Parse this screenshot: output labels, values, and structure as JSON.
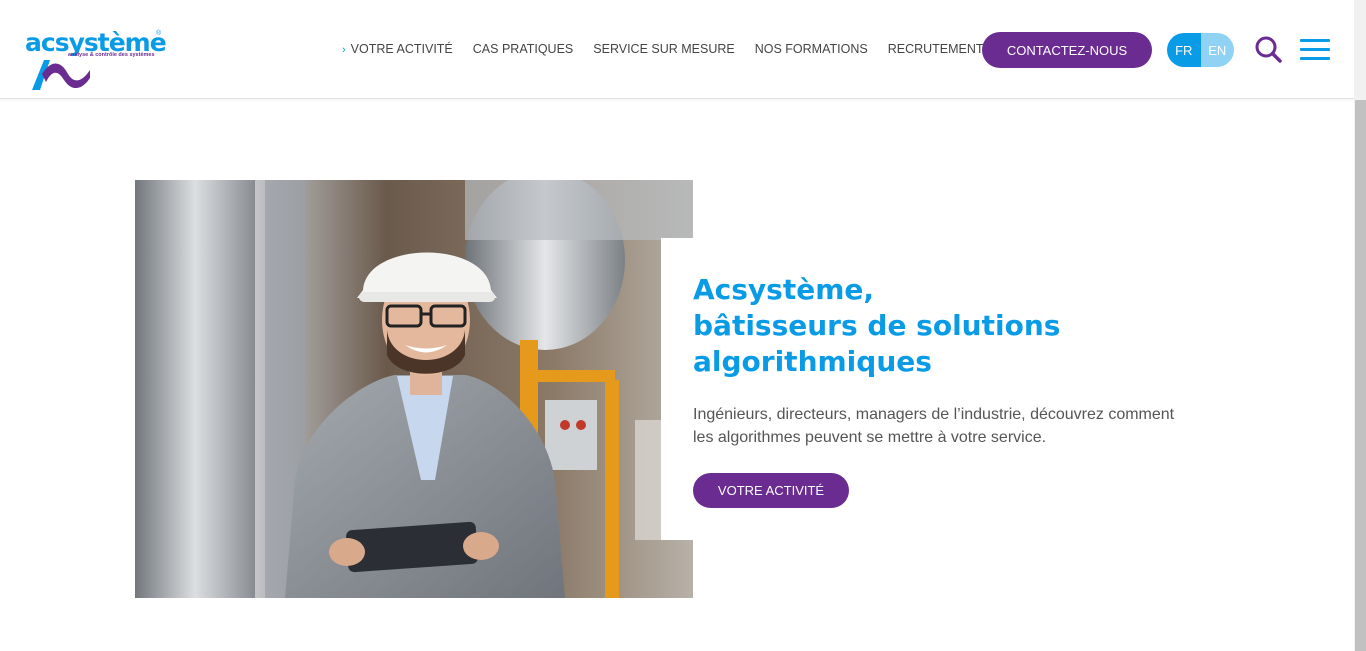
{
  "brand": {
    "name": "acsystème",
    "tagline": "analyse & contrôle des systèmes",
    "registered": "®"
  },
  "nav": {
    "items": [
      {
        "label": "VOTRE ACTIVITÉ",
        "active": true
      },
      {
        "label": "CAS PRATIQUES"
      },
      {
        "label": "SERVICE SUR MESURE"
      },
      {
        "label": "NOS FORMATIONS"
      },
      {
        "label": "RECRUTEMENT"
      }
    ],
    "contact_label": "CONTACTEZ-NOUS",
    "languages": [
      "FR",
      "EN"
    ],
    "active_language": "FR"
  },
  "icons": {
    "search": "search-icon",
    "menu": "hamburger-menu-icon",
    "chevron": "chevron-right-icon"
  },
  "hero": {
    "title_lines": [
      "Acsystème,",
      "bâtisseurs de solutions",
      "algorithmiques"
    ],
    "description_line1": "Ingénieurs, directeurs, managers de l’industrie, découvrez comment",
    "description_line2": "les algorithmes peuvent se mettre à votre service.",
    "cta_label": "VOTRE ACTIVITÉ"
  },
  "colors": {
    "brand_blue": "#0a9be6",
    "brand_purple": "#6a2c91",
    "lang_inactive": "#8fd2f4",
    "text_gray": "#555555"
  }
}
